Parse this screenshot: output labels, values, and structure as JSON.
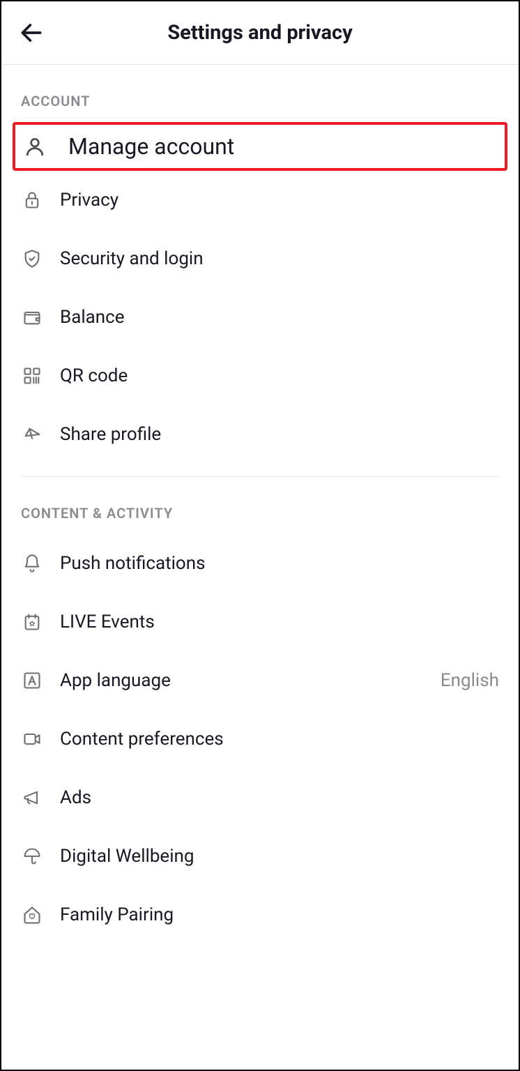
{
  "header": {
    "title": "Settings and privacy"
  },
  "sections": {
    "account": {
      "header": "ACCOUNT",
      "items": {
        "manage_account": {
          "label": "Manage account"
        },
        "privacy": {
          "label": "Privacy"
        },
        "security": {
          "label": "Security and login"
        },
        "balance": {
          "label": "Balance"
        },
        "qr_code": {
          "label": "QR code"
        },
        "share_profile": {
          "label": "Share profile"
        }
      }
    },
    "content": {
      "header": "CONTENT & ACTIVITY",
      "items": {
        "push": {
          "label": "Push notifications"
        },
        "live": {
          "label": "LIVE Events"
        },
        "language": {
          "label": "App language",
          "value": "English"
        },
        "content_prefs": {
          "label": "Content preferences"
        },
        "ads": {
          "label": "Ads"
        },
        "wellbeing": {
          "label": "Digital Wellbeing"
        },
        "family": {
          "label": "Family Pairing"
        }
      }
    }
  }
}
